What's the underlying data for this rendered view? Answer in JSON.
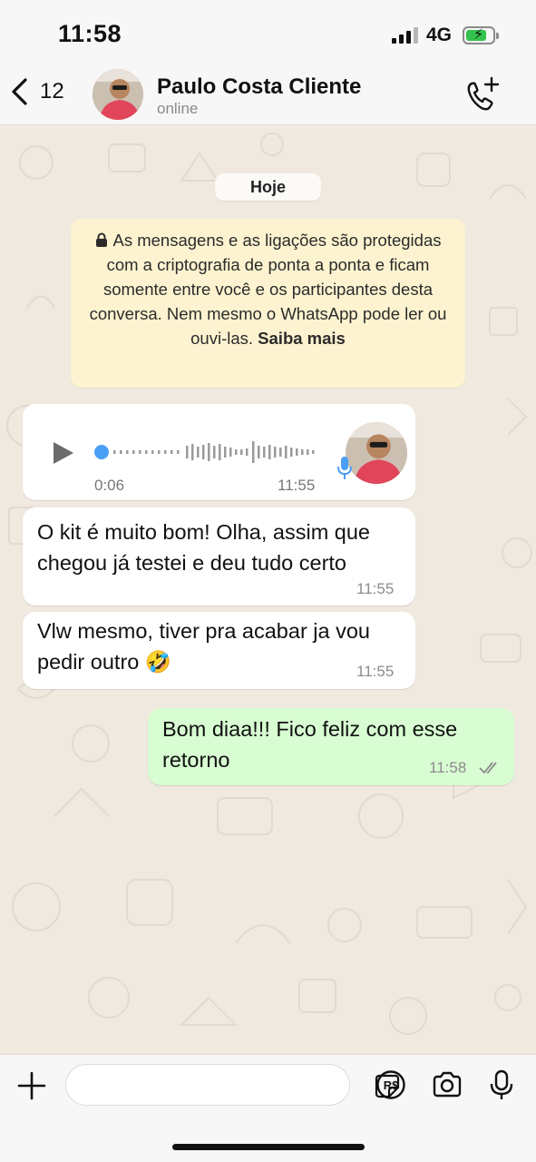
{
  "status_bar": {
    "time": "11:58",
    "network": "4G"
  },
  "header": {
    "back_count": "12",
    "contact_name": "Paulo Costa Cliente",
    "contact_status": "online"
  },
  "chat": {
    "day_label": "Hoje",
    "encryption_notice": "As mensagens e as ligações são protegidas com a criptografia de ponta a ponta e ficam somente entre você e os participantes desta conversa. Nem mesmo o WhatsApp pode ler ou ouvi-las.",
    "encryption_link": "Saiba mais",
    "audio": {
      "duration": "0:06",
      "time": "11:55"
    },
    "messages": [
      {
        "line1": "O kit é muito bom! Olha, assim que",
        "line2": "chegou já testei e deu tudo certo",
        "time": "11:55",
        "direction": "in"
      },
      {
        "line1": "Vlw mesmo, tiver pra acabar ja vou",
        "line2": "pedir outro 🤣",
        "time": "11:55",
        "direction": "in"
      },
      {
        "line1": "Bom diaa!!! Fico feliz com esse",
        "line2": "retorno",
        "time": "11:58",
        "direction": "out"
      }
    ]
  },
  "colors": {
    "outgoing_bubble": "#d8fdd2",
    "incoming_bubble": "#ffffff",
    "notice_bg": "#fdf3d0",
    "accent_blue": "#4a9ff5"
  },
  "icons": [
    "back-chevron-icon",
    "call-add-icon",
    "lock-icon",
    "play-icon",
    "mic-icon",
    "plus-icon",
    "sticker-icon",
    "pix-icon",
    "camera-icon",
    "double-check-icon"
  ]
}
